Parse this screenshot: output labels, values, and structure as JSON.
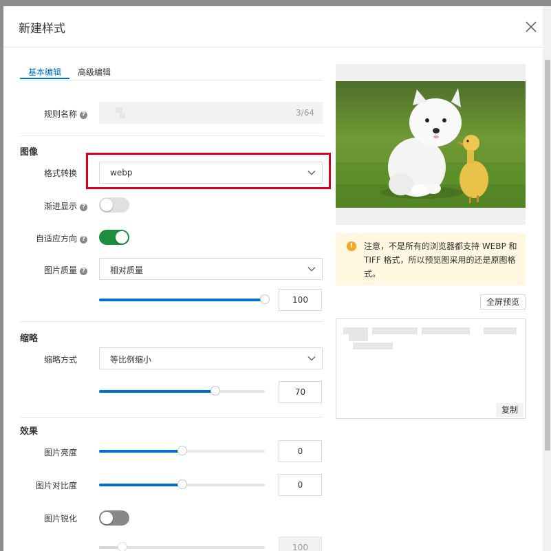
{
  "dialog": {
    "title": "新建样式"
  },
  "tabs": [
    {
      "label": "基本编辑",
      "active": true
    },
    {
      "label": "高级编辑",
      "active": false
    }
  ],
  "rule_name": {
    "label": "规则名称",
    "counter": "3/64"
  },
  "image_section": {
    "title": "图像",
    "format_label": "格式转换",
    "format_value": "webp",
    "progressive_label": "渐进显示",
    "progressive_on": false,
    "auto_orient_label": "自适应方向",
    "auto_orient_on": true,
    "quality_label": "图片质量",
    "quality_mode": "相对质量",
    "quality_value": "100",
    "quality_fraction": 1.0
  },
  "thumbnail_section": {
    "title": "缩略",
    "method_label": "缩略方式",
    "method_value": "等比例缩小",
    "value": "70",
    "fraction": 0.7
  },
  "effects_section": {
    "title": "效果",
    "brightness_label": "图片亮度",
    "brightness_value": "0",
    "brightness_fraction": 0.5,
    "contrast_label": "图片对比度",
    "contrast_value": "0",
    "contrast_fraction": 0.5,
    "sharpen_label": "图片锐化",
    "sharpen_on": false,
    "sharpen_value": "100",
    "sharpen_fraction": 0.14
  },
  "preview": {
    "notice": "注意，不是所有的浏览器都支持 WEBP 和 TIFF 格式，所以预览图采用的还是原图格式。",
    "fullscreen_label": "全屏预览",
    "copy_label": "复制"
  },
  "colors": {
    "accent": "#0070cc",
    "toggle_on": "#1e8e3e",
    "toggle_off": "#e0e0e0",
    "highlight": "#d9001b",
    "notice_bg": "#fff7e0",
    "warn_icon": "#f5a623"
  }
}
